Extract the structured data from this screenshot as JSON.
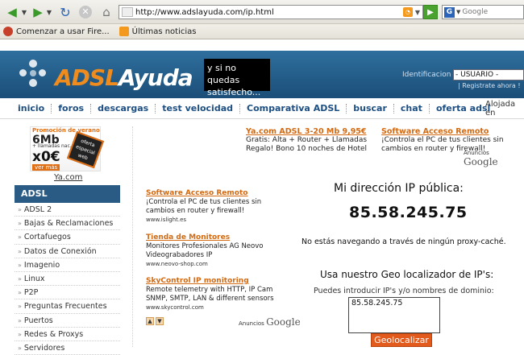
{
  "browser": {
    "url": "http://www.adslayuda.com/ip.html",
    "search_engine": "Google",
    "bookmarks": [
      {
        "label": "Comenzar a usar Fire..."
      },
      {
        "label": "Últimas noticias"
      }
    ]
  },
  "header": {
    "logo_adsl": "ADSL",
    "logo_ayuda": "Ayuda",
    "banner_text": "y si no quedas satisfecho...",
    "ident_label": "Identificacion :",
    "ident_value": "- USUARIO -",
    "register": "| Registrate ahora !"
  },
  "nav": {
    "items": [
      "inicio",
      "foros",
      "descargas",
      "test velocidad",
      "Comparativa ADSL",
      "buscar",
      "chat",
      "oferta adsl"
    ],
    "alojada": "Alojada en"
  },
  "promo": {
    "line1": "Promoción de verano",
    "line2": "6Mb",
    "line3": "+ llamadas nac.",
    "line4": "x0€",
    "chip": "oferta especial web",
    "ver_mas": "ver más",
    "link": "Ya.com"
  },
  "sidebar": {
    "title": "ADSL",
    "items": [
      "ADSL 2",
      "Bajas & Reclamaciones",
      "Cortafuegos",
      "Datos de Conexión",
      "Imagenio",
      "Linux",
      "P2P",
      "Preguntas Frecuentes",
      "Puertos",
      "Redes & Proxys",
      "Servidores"
    ]
  },
  "top_ads": [
    {
      "title": "Ya.com ADSL 3-20 Mb 9,95€",
      "desc": "Gratis: Alta + Router + Llamadas Regalo! Bono 10 noches de Hotel"
    },
    {
      "title": "Software Acceso Remoto",
      "desc": "¡Controla el PC de tus clientes sin cambios en router y firewall!"
    }
  ],
  "left_ads": [
    {
      "title": "Software Acceso Remoto",
      "desc": "¡Controla el PC de tus clientes sin cambios en router y firewall!",
      "url": "www.islight.es"
    },
    {
      "title": "Tienda de Monitores",
      "desc": "Monitores Profesionales AG Neovo Videograbadores IP",
      "url": "www.neovo-shop.com"
    },
    {
      "title": "SkyControl IP monitoring",
      "desc": "Remote telemetry with HTTP, IP Cam SNMP, SMTP, LAN & different sensors",
      "url": "www.skycontrol.com"
    }
  ],
  "anuncios": {
    "label": "Anuncios",
    "brand": "Google"
  },
  "ip": {
    "title": "Mi dirección IP pública:",
    "value": "85.58.245.75",
    "proxy_msg": "No estás navegando a través de ningún proxy-caché."
  },
  "geo": {
    "title": "Usa nuestro Geo localizador de IP's:",
    "subtitle": "Puedes introducir IP's y/o nombres de dominio:",
    "text_value": "85.58.245.75",
    "button": "Geolocalizar"
  }
}
